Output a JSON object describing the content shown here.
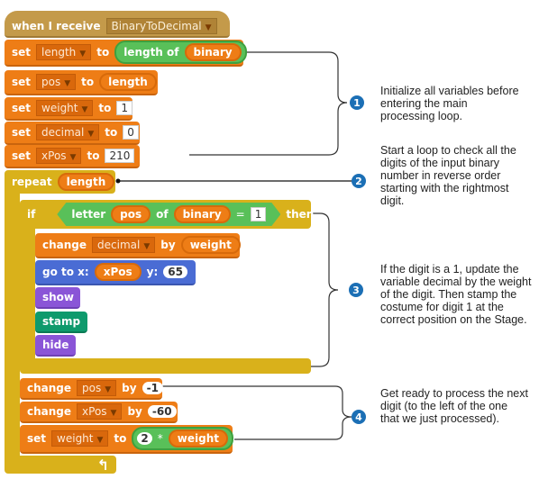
{
  "script": {
    "hat": {
      "label": "when I receive",
      "message": "BinaryToDecimal"
    },
    "init": [
      {
        "op": "set",
        "var": "length",
        "to_label": "to",
        "value": {
          "reporter": "length of",
          "arg": "binary"
        }
      },
      {
        "op": "set",
        "var": "pos",
        "to_label": "to",
        "value": {
          "var": "length"
        }
      },
      {
        "op": "set",
        "var": "weight",
        "to_label": "to",
        "value": {
          "num": "1"
        }
      },
      {
        "op": "set",
        "var": "decimal",
        "to_label": "to",
        "value": {
          "num": "0"
        }
      },
      {
        "op": "set",
        "var": "xPos",
        "to_label": "to",
        "value": {
          "num": "210"
        }
      }
    ],
    "repeat": {
      "label": "repeat",
      "arg": "length"
    },
    "if_block": {
      "label": "if",
      "cond": {
        "reporter": "letter",
        "arg1": "pos",
        "of": "of",
        "arg2": "binary",
        "eq": "=",
        "value": "1"
      },
      "then": "then"
    },
    "if_body": {
      "change": {
        "label": "change",
        "var": "decimal",
        "by": "by",
        "value": "weight"
      },
      "goto": {
        "label": "go to x:",
        "x": "xPos",
        "y_label": "y:",
        "y": "65"
      },
      "show": "show",
      "stamp": "stamp",
      "hide": "hide"
    },
    "tail": {
      "change_pos": {
        "label": "change",
        "var": "pos",
        "by": "by",
        "value": "-1"
      },
      "change_xpos": {
        "label": "change",
        "var": "xPos",
        "by": "by",
        "value": "-60"
      },
      "set_weight": {
        "label": "set",
        "var": "weight",
        "to": "to",
        "left": "2",
        "op": "*",
        "right": "weight"
      }
    },
    "loop_arrow": "↰"
  },
  "annotations": [
    {
      "number": "1",
      "text": "Initialize all variables before entering the main processing loop."
    },
    {
      "number": "2",
      "text": "Start a loop to check all the digits of the input binary number in reverse order starting with the rightmost digit."
    },
    {
      "number": "3",
      "text": "If the digit is a 1, update the variable decimal by the weight of the digit. Then stamp the costume for digit 1 at the correct position on the Stage."
    },
    {
      "number": "4",
      "text": "Get ready to process the next digit (to the left of the one that we just processed)."
    }
  ],
  "colors": {
    "events": "#c49a4a",
    "variables": "#ee7d16",
    "control": "#d9b11b",
    "operators": "#59c059",
    "motion": "#4a6cd4",
    "looks": "#8a55d7",
    "pen": "#0e9a6c",
    "badge": "#1b6fb5"
  }
}
